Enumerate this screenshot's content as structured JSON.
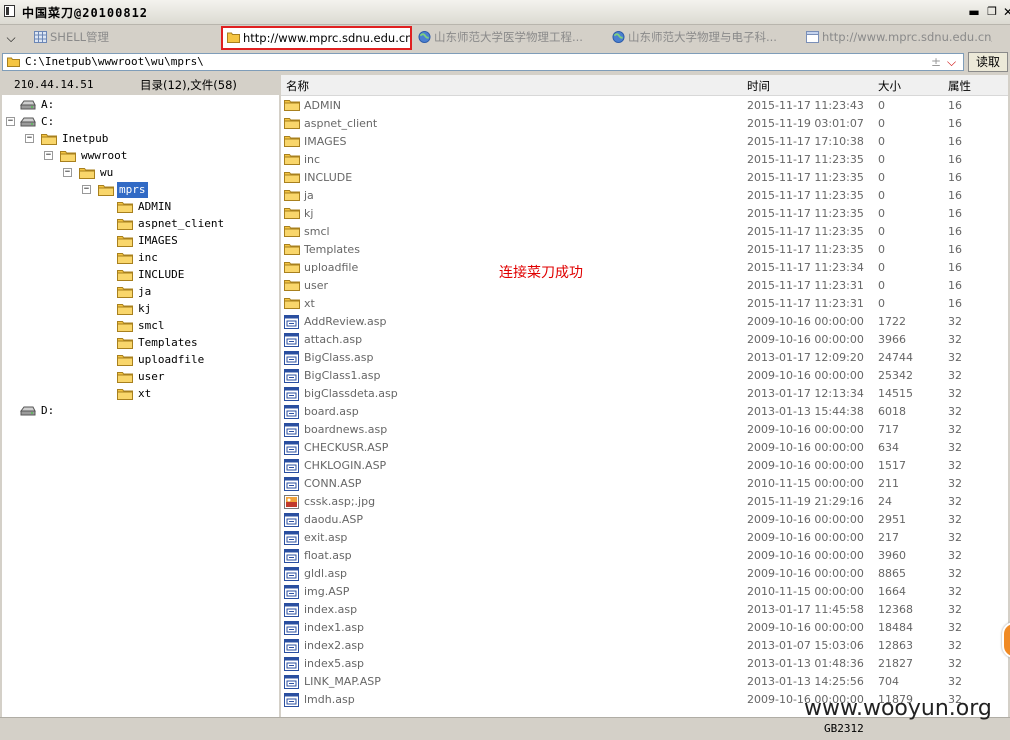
{
  "app": {
    "title": "中国菜刀@20100812"
  },
  "tabs": [
    {
      "label": "SHELL管理",
      "active": false,
      "icon": "grid-icon"
    },
    {
      "label": "http://www.mprc.sdnu.edu.cn/c...",
      "active": true,
      "icon": "folder-icon"
    },
    {
      "label": "山东师范大学医学物理工程...",
      "active": false,
      "icon": "globe-icon"
    },
    {
      "label": "山东师范大学物理与电子科...",
      "active": false,
      "icon": "globe-icon"
    },
    {
      "label": "http://www.mprc.sdnu.edu.cn/c...",
      "active": false,
      "icon": "page-icon"
    }
  ],
  "address": {
    "path": "C:\\Inetpub\\wwwroot\\wu\\mprs\\",
    "read_label": "读取"
  },
  "info": {
    "ip": "210.44.14.51",
    "counts": "目录(12),文件(58)"
  },
  "tree": [
    {
      "label": "A:",
      "type": "drive"
    },
    {
      "label": "C:",
      "type": "drive"
    },
    {
      "label": "Inetpub",
      "type": "folder"
    },
    {
      "label": "wwwroot",
      "type": "folder"
    },
    {
      "label": "wu",
      "type": "folder"
    },
    {
      "label": "mprs",
      "type": "folder"
    },
    {
      "label": "ADMIN",
      "type": "folder"
    },
    {
      "label": "aspnet_client",
      "type": "folder"
    },
    {
      "label": "IMAGES",
      "type": "folder"
    },
    {
      "label": "inc",
      "type": "folder"
    },
    {
      "label": "INCLUDE",
      "type": "folder"
    },
    {
      "label": "ja",
      "type": "folder"
    },
    {
      "label": "kj",
      "type": "folder"
    },
    {
      "label": "smcl",
      "type": "folder"
    },
    {
      "label": "Templates",
      "type": "folder"
    },
    {
      "label": "uploadfile",
      "type": "folder"
    },
    {
      "label": "user",
      "type": "folder"
    },
    {
      "label": "xt",
      "type": "folder"
    },
    {
      "label": "D:",
      "type": "drive"
    }
  ],
  "columns": {
    "name": "名称",
    "time": "时间",
    "size": "大小",
    "attr": "属性"
  },
  "files": [
    {
      "name": "ADMIN",
      "time": "2015-11-17 11:23:43",
      "size": "0",
      "attr": "16",
      "type": "folder"
    },
    {
      "name": "aspnet_client",
      "time": "2015-11-19 03:01:07",
      "size": "0",
      "attr": "16",
      "type": "folder"
    },
    {
      "name": "IMAGES",
      "time": "2015-11-17 17:10:38",
      "size": "0",
      "attr": "16",
      "type": "folder"
    },
    {
      "name": "inc",
      "time": "2015-11-17 11:23:35",
      "size": "0",
      "attr": "16",
      "type": "folder"
    },
    {
      "name": "INCLUDE",
      "time": "2015-11-17 11:23:35",
      "size": "0",
      "attr": "16",
      "type": "folder"
    },
    {
      "name": "ja",
      "time": "2015-11-17 11:23:35",
      "size": "0",
      "attr": "16",
      "type": "folder"
    },
    {
      "name": "kj",
      "time": "2015-11-17 11:23:35",
      "size": "0",
      "attr": "16",
      "type": "folder"
    },
    {
      "name": "smcl",
      "time": "2015-11-17 11:23:35",
      "size": "0",
      "attr": "16",
      "type": "folder"
    },
    {
      "name": "Templates",
      "time": "2015-11-17 11:23:35",
      "size": "0",
      "attr": "16",
      "type": "folder"
    },
    {
      "name": "uploadfile",
      "time": "2015-11-17 11:23:34",
      "size": "0",
      "attr": "16",
      "type": "folder"
    },
    {
      "name": "user",
      "time": "2015-11-17 11:23:31",
      "size": "0",
      "attr": "16",
      "type": "folder"
    },
    {
      "name": "xt",
      "time": "2015-11-17 11:23:31",
      "size": "0",
      "attr": "16",
      "type": "folder"
    },
    {
      "name": "AddReview.asp",
      "time": "2009-10-16 00:00:00",
      "size": "1722",
      "attr": "32",
      "type": "asp"
    },
    {
      "name": "attach.asp",
      "time": "2009-10-16 00:00:00",
      "size": "3966",
      "attr": "32",
      "type": "asp"
    },
    {
      "name": "BigClass.asp",
      "time": "2013-01-17 12:09:20",
      "size": "24744",
      "attr": "32",
      "type": "asp"
    },
    {
      "name": "BigClass1.asp",
      "time": "2009-10-16 00:00:00",
      "size": "25342",
      "attr": "32",
      "type": "asp"
    },
    {
      "name": "bigClassdeta.asp",
      "time": "2013-01-17 12:13:34",
      "size": "14515",
      "attr": "32",
      "type": "asp"
    },
    {
      "name": "board.asp",
      "time": "2013-01-13 15:44:38",
      "size": "6018",
      "attr": "32",
      "type": "asp"
    },
    {
      "name": "boardnews.asp",
      "time": "2009-10-16 00:00:00",
      "size": "717",
      "attr": "32",
      "type": "asp"
    },
    {
      "name": "CHECKUSR.ASP",
      "time": "2009-10-16 00:00:00",
      "size": "634",
      "attr": "32",
      "type": "asp"
    },
    {
      "name": "CHKLOGIN.ASP",
      "time": "2009-10-16 00:00:00",
      "size": "1517",
      "attr": "32",
      "type": "asp"
    },
    {
      "name": "CONN.ASP",
      "time": "2010-11-15 00:00:00",
      "size": "211",
      "attr": "32",
      "type": "asp"
    },
    {
      "name": "cssk.asp;.jpg",
      "time": "2015-11-19 21:29:16",
      "size": "24",
      "attr": "32",
      "type": "image"
    },
    {
      "name": "daodu.ASP",
      "time": "2009-10-16 00:00:00",
      "size": "2951",
      "attr": "32",
      "type": "asp"
    },
    {
      "name": "exit.asp",
      "time": "2009-10-16 00:00:00",
      "size": "217",
      "attr": "32",
      "type": "asp"
    },
    {
      "name": "float.asp",
      "time": "2009-10-16 00:00:00",
      "size": "3960",
      "attr": "32",
      "type": "asp"
    },
    {
      "name": "gldl.asp",
      "time": "2009-10-16 00:00:00",
      "size": "8865",
      "attr": "32",
      "type": "asp"
    },
    {
      "name": "img.ASP",
      "time": "2010-11-15 00:00:00",
      "size": "1664",
      "attr": "32",
      "type": "asp"
    },
    {
      "name": "index.asp",
      "time": "2013-01-17 11:45:58",
      "size": "12368",
      "attr": "32",
      "type": "asp"
    },
    {
      "name": "index1.asp",
      "time": "2009-10-16 00:00:00",
      "size": "18484",
      "attr": "32",
      "type": "asp"
    },
    {
      "name": "index2.asp",
      "time": "2013-01-07 15:03:06",
      "size": "12863",
      "attr": "32",
      "type": "asp"
    },
    {
      "name": "index5.asp",
      "time": "2013-01-13 01:48:36",
      "size": "21827",
      "attr": "32",
      "type": "asp"
    },
    {
      "name": "LINK_MAP.ASP",
      "time": "2013-01-13 14:25:56",
      "size": "704",
      "attr": "32",
      "type": "asp"
    },
    {
      "name": "lmdh.asp",
      "time": "2009-10-16 00:00:00",
      "size": "11879",
      "attr": "32",
      "type": "asp"
    }
  ],
  "annotation": "连接菜刀成功",
  "status": {
    "encoding": "GB2312"
  },
  "watermark": "www.wooyun.org",
  "colors": {
    "selection": "#316ac5",
    "highlight_border": "#e02020",
    "annotation": "#e00000",
    "folder": "#f5c542"
  }
}
